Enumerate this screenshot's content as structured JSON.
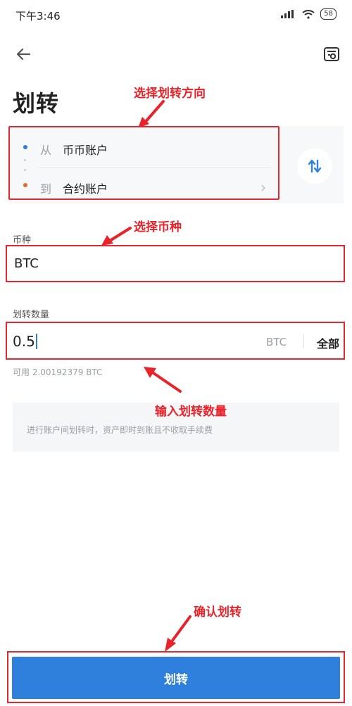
{
  "status_bar": {
    "time": "下午3:46",
    "battery": "58"
  },
  "header": {
    "title": "划转"
  },
  "annotations": {
    "direction": "选择划转方向",
    "coin": "选择币种",
    "amount": "输入划转数量",
    "confirm": "确认划转"
  },
  "direction": {
    "from_label": "从",
    "from_value": "币币账户",
    "to_label": "到",
    "to_value": "合约账户"
  },
  "coin": {
    "label": "币种",
    "value": "BTC"
  },
  "amount": {
    "label": "划转数量",
    "value": "0.5",
    "unit": "BTC",
    "all_label": "全部"
  },
  "available": "可用 2.00192379 BTC",
  "notice": "进行账户间划转时，资产即时到账且不收取手续费",
  "submit_label": "划转",
  "colors": {
    "accent": "#2f80dd",
    "annotation": "#e8242a",
    "from_dot": "#2e7bd8",
    "to_dot": "#e06a2c"
  },
  "icons": [
    "back-arrow-icon",
    "record-icon",
    "swap-icon",
    "chevron-right-icon",
    "signal-icon",
    "wifi-icon",
    "battery-icon"
  ]
}
